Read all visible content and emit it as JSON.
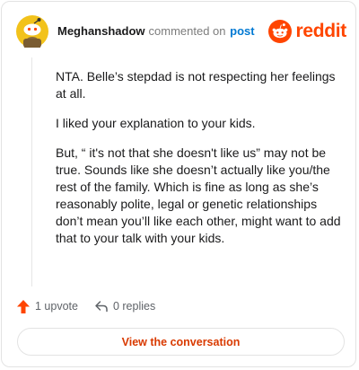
{
  "comment": {
    "username": "Meghanshadow",
    "action_text": "commented on",
    "post_link_text": "post",
    "brand_name": "reddit",
    "paragraphs": [
      "NTA. Belle’s stepdad is not respecting her feelings at all.",
      "I liked your explanation to your kids.",
      "But, “ it's not that she doesn't like us” may not be true. Sounds like she doesn’t actually like you/the rest of the family. Which is fine as long as she’s reasonably polite, legal or genetic relationships don’t mean you’ll like each other, might want to add that to your talk with your kids."
    ]
  },
  "actions": {
    "upvote_label": "1 upvote",
    "replies_label": "0 replies"
  },
  "cta": {
    "label": "View the conversation"
  },
  "colors": {
    "brand": "#ff4500",
    "link": "#0079d3",
    "avatar_bg": "#f2c21b",
    "cta_text": "#d93a00"
  },
  "icons": {
    "avatar": "snoo-avatar-icon",
    "brand": "reddit-logo-icon",
    "upvote": "upvote-arrow-icon",
    "reply": "reply-arrow-icon"
  }
}
